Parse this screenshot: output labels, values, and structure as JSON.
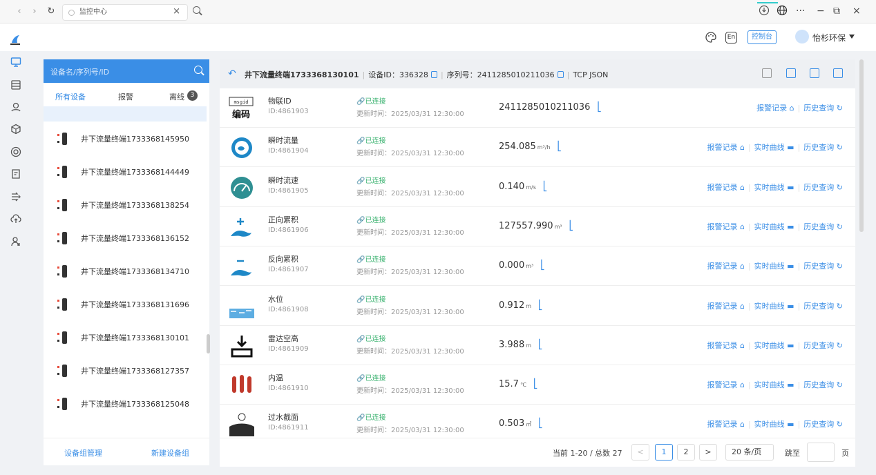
{
  "browser": {
    "tab_title": "监控中心",
    "close": "×",
    "window_controls": [
      "···",
      "−",
      "⧉",
      "×"
    ]
  },
  "header": {
    "lang": "En",
    "console_label": "控制台",
    "user": "怡杉环保"
  },
  "device_panel": {
    "search_placeholder": "设备名/序列号/ID",
    "tabs": [
      "所有设备",
      "报警",
      "离线"
    ],
    "offline_count": "3",
    "devices": [
      "井下流量终端1733368145950",
      "井下流量终端1733368144449",
      "井下流量终端1733368138254",
      "井下流量终端1733368136152",
      "井下流量终端1733368134710",
      "井下流量终端1733368131696",
      "井下流量终端1733368130101",
      "井下流量终端1733368127357",
      "井下流量终端1733368125048"
    ],
    "footer": {
      "group_manage": "设备组管理",
      "new_group": "新建设备组"
    }
  },
  "detail": {
    "title": "井下流量终端1733368130101",
    "device_id": "设备ID：336328",
    "serial": "序列号：2411285010211036",
    "protocol": "TCP JSON",
    "status_text": "已连接",
    "update_prefix": "更新时间：",
    "update_time": "2025/03/31 12:30:00",
    "action_alarm": "报警记录",
    "action_curve": "实时曲线",
    "action_history": "历史查询",
    "rows": [
      {
        "name": "物联ID",
        "id": "ID:4861903",
        "value": "2411285010211036",
        "unit": "",
        "curve": false,
        "icon": "msgid-code-icon"
      },
      {
        "name": "瞬时流量",
        "id": "ID:4861904",
        "value": "254.085",
        "unit": "m³/h",
        "curve": true,
        "icon": "flow-icon"
      },
      {
        "name": "瞬时流速",
        "id": "ID:4861905",
        "value": "0.140",
        "unit": "m/s",
        "curve": true,
        "icon": "speed-gauge-icon"
      },
      {
        "name": "正向累积",
        "id": "ID:4861906",
        "value": "127557.990",
        "unit": "m³",
        "curve": true,
        "icon": "forward-accumulate-icon"
      },
      {
        "name": "反向累积",
        "id": "ID:4861907",
        "value": "0.000",
        "unit": "m³",
        "curve": true,
        "icon": "reverse-accumulate-icon"
      },
      {
        "name": "水位",
        "id": "ID:4861908",
        "value": "0.912",
        "unit": "m",
        "curve": true,
        "icon": "water-level-icon"
      },
      {
        "name": "雷达空高",
        "id": "ID:4861909",
        "value": "3.988",
        "unit": "m",
        "curve": true,
        "icon": "radar-height-icon"
      },
      {
        "name": "内温",
        "id": "ID:4861910",
        "value": "15.7",
        "unit": "℃",
        "curve": true,
        "icon": "thermometer-icon"
      },
      {
        "name": "过水截面",
        "id": "ID:4861911",
        "value": "0.503",
        "unit": "㎡",
        "curve": true,
        "icon": "cross-section-icon"
      }
    ]
  },
  "pager": {
    "info": "当前 1-20 / 总数 27",
    "prev": "<",
    "pages": [
      "1",
      "2"
    ],
    "next": ">",
    "page_size": "20 条/页",
    "jump": "跳至",
    "unit": "页"
  }
}
